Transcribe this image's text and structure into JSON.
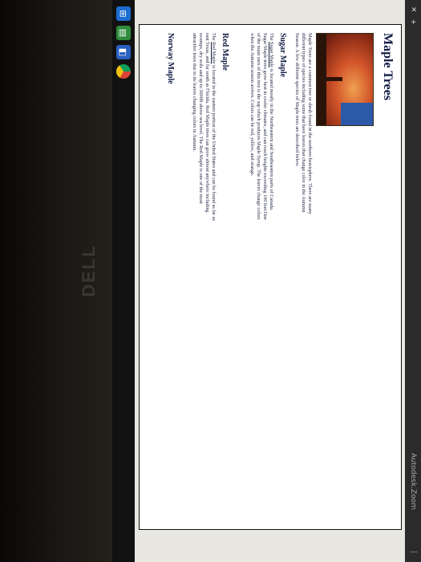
{
  "browser": {
    "url": "Autodesk.Zoom"
  },
  "article": {
    "title": "Maple Trees",
    "intro": "Maple Trees are a common tree or shrub found in the northern hemisphere. There are many different types of species including some that have leaves that change color in the Autumn Season. A few different species of Maple trees are described below.",
    "sections": [
      {
        "heading": "Sugar Maple",
        "link_text": "Sugar Maple",
        "body": "The Sugar Maple is located mostly in the Northeastern and Southeastern parts of Canada. Sugar Maple trees grow best in cooler climates, and can reach heights exceeding 100 feet.One of the main uses of this tree is the sap which produces Maple Syrup. The leaves change colors when the Autumn season arrives. Colors can be red, yellow, and orange."
      },
      {
        "heading": "Red Maple",
        "link_text": "Red Maple",
        "body": "The Red Maple is located in the eastern portion of the United States and can be found as far as east Texas, and far south as Florida. Red Maple trees can grow almost anywhere including swamps, dry soils and up to 3000ft above sea level. The Red Maple is one of the most attractive trees due to its leaves changing colors in Autumn."
      },
      {
        "heading": "Norway Maple"
      }
    ]
  },
  "device": {
    "brand": "DELL"
  }
}
